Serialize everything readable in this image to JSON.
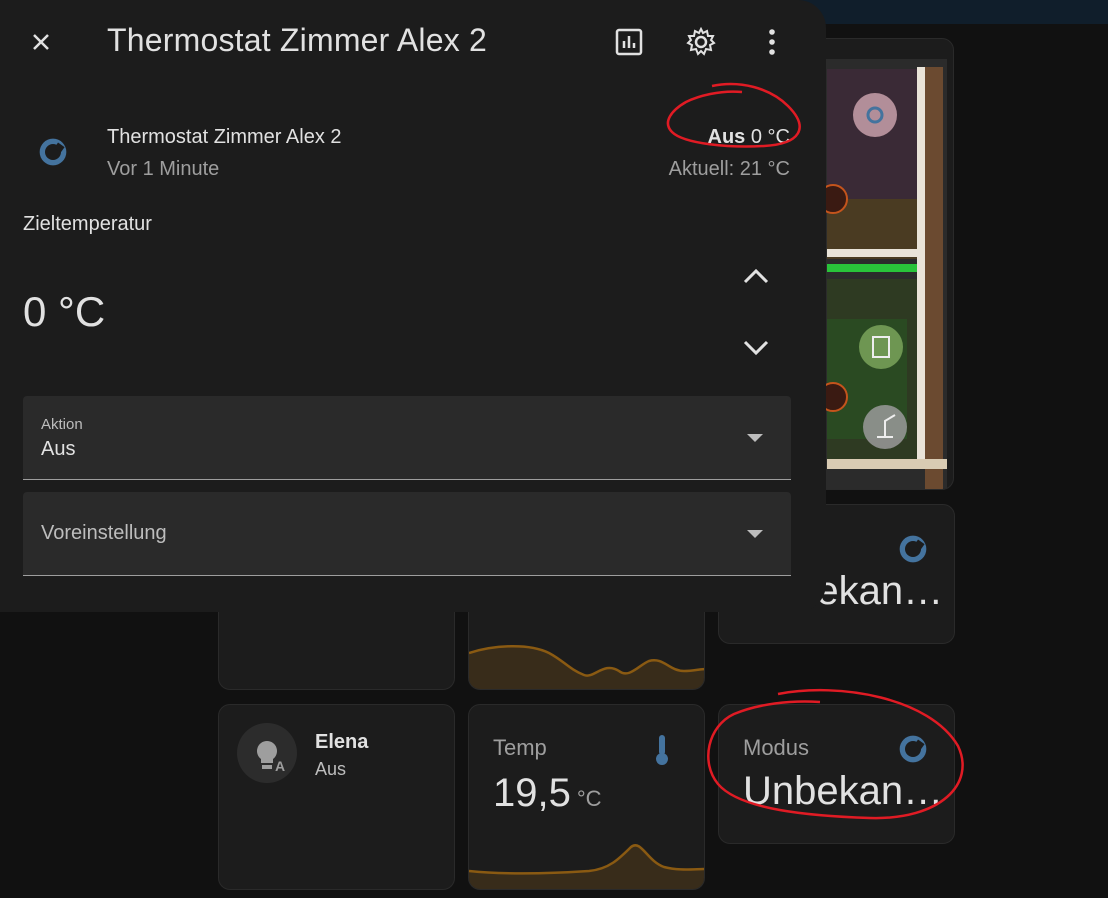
{
  "dialog": {
    "title": "Thermostat Zimmer Alex 2",
    "entity": {
      "name": "Thermostat Zimmer Alex 2",
      "last_changed": "Vor 1 Minute",
      "state_mode": "Aus",
      "state_temp": "0 °C",
      "current": "Aktuell: 21 °C"
    },
    "target_label": "Zieltemperatur",
    "target_value": "0 °C",
    "action_select": {
      "label": "Aktion",
      "value": "Aus"
    },
    "preset_select": {
      "placeholder": "Voreinstellung"
    }
  },
  "background_cards": {
    "modus_top": {
      "value": "Unbekan…"
    },
    "elena": {
      "name": "Elena",
      "state": "Aus"
    },
    "temp": {
      "label": "Temp",
      "value": "19,5",
      "unit": "°C"
    },
    "modus_bottom": {
      "label": "Modus",
      "value": "Unbekan…"
    }
  },
  "icons": {
    "close": "close-icon",
    "history": "chart-icon",
    "settings": "gear-icon",
    "menu": "dots-vertical-icon",
    "thermostat": "thermostat-icon",
    "increase": "chevron-up-icon",
    "decrease": "chevron-down-icon",
    "thermometer": "thermometer-icon",
    "lightbulb": "lightbulb-auto-icon"
  },
  "colors": {
    "accent_blue": "#44739e",
    "annotation_red": "#e01b24",
    "sparkline": "#8a5a12",
    "dialog_bg": "#1c1c1c"
  }
}
